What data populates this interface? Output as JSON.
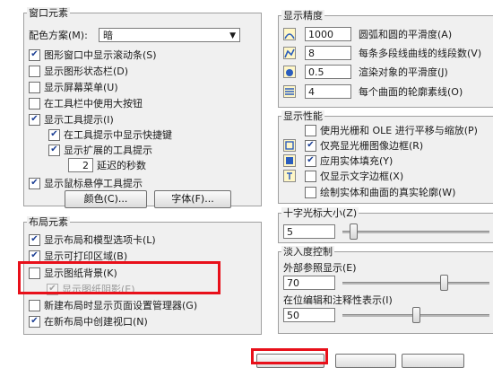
{
  "window_elements": {
    "title": "窗口元素",
    "color_scheme_label": "配色方案(M):",
    "color_scheme_value": "暗",
    "items": [
      {
        "label": "图形窗口中显示滚动条(S)",
        "checked": true
      },
      {
        "label": "显示图形状态栏(D)",
        "checked": false
      },
      {
        "label": "显示屏幕菜单(U)",
        "checked": false
      },
      {
        "label": "在工具栏中使用大按钮",
        "checked": false
      },
      {
        "label": "显示工具提示(I)",
        "checked": true
      }
    ],
    "sub_items": [
      {
        "label": "在工具提示中显示快捷键",
        "checked": true
      },
      {
        "label": "显示扩展的工具提示",
        "checked": true
      }
    ],
    "delay_value": "2",
    "delay_label": "延迟的秒数",
    "rollover_label": "显示鼠标悬停工具提示",
    "colors_button": "颜色(C)...",
    "fonts_button": "字体(F)..."
  },
  "layout_elements": {
    "title": "布局元素",
    "items": [
      {
        "label": "显示布局和模型选项卡(L)",
        "checked": true
      },
      {
        "label": "显示可打印区域(B)",
        "checked": true
      },
      {
        "label": "显示图纸背景(K)",
        "checked": false
      },
      {
        "label": "显示图纸阴影(E)",
        "checked": true,
        "disabled": true
      },
      {
        "label": "新建布局时显示页面设置管理器(G)",
        "checked": false
      },
      {
        "label": "在新布局中创建视口(N)",
        "checked": true
      }
    ]
  },
  "display_resolution": {
    "title": "显示精度",
    "items": [
      {
        "value": "1000",
        "label": "圆弧和圆的平滑度(A)"
      },
      {
        "value": "8",
        "label": "每条多段线曲线的线段数(V)"
      },
      {
        "value": "0.5",
        "label": "渲染对象的平滑度(J)"
      },
      {
        "value": "4",
        "label": "每个曲面的轮廓素线(O)"
      }
    ]
  },
  "display_performance": {
    "title": "显示性能",
    "items": [
      {
        "label": "使用光栅和 OLE 进行平移与缩放(P)",
        "checked": false,
        "icon": false
      },
      {
        "label": "仅亮显光栅图像边框(R)",
        "checked": true,
        "icon": true
      },
      {
        "label": "应用实体填充(Y)",
        "checked": true,
        "icon": true
      },
      {
        "label": "仅显示文字边框(X)",
        "checked": false,
        "icon": true
      },
      {
        "label": "绘制实体和曲面的真实轮廓(W)",
        "checked": false,
        "icon": false
      }
    ]
  },
  "crosshair": {
    "title": "十字光标大小(Z)",
    "value": "5",
    "level": 5
  },
  "fade_control": {
    "title": "淡入度控制",
    "xref_label": "外部参照显示(E)",
    "xref_value": "70",
    "xref_level": 70,
    "inplace_label": "在位编辑和注释性表示(I)",
    "inplace_value": "50",
    "inplace_level": 50
  },
  "colors": {
    "highlight": "#e8101a",
    "panel_bg": "#f0f0f0",
    "check": "#1c3f94"
  }
}
